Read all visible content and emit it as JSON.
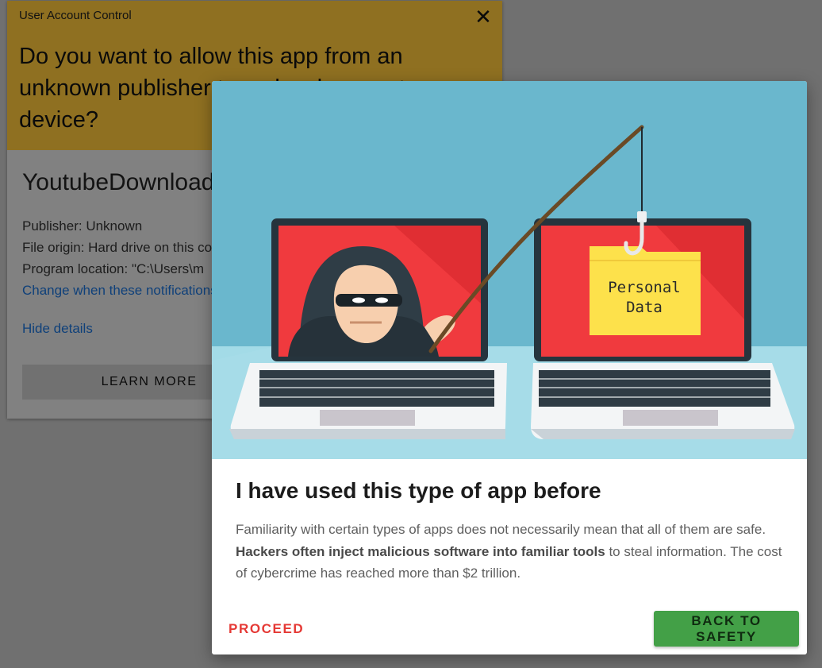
{
  "uac": {
    "caption": "User Account Control",
    "question": "Do you want to allow this app from an unknown publisher to make changes to your device?",
    "app_name": "YoutubeDownloader",
    "details": [
      "Publisher: Unknown",
      "File origin: Hard drive on this computer",
      "Program location: \"C:\\Users\\m"
    ],
    "change_link": "Change when these notifications appear",
    "hide_details": "Hide details",
    "learn_more": "LEARN MORE",
    "close_icon": "close-icon",
    "header_color": "#ffc83b"
  },
  "modal": {
    "illustration": {
      "folder_text_line1": "Personal",
      "folder_text_line2": "Data"
    },
    "title": "I have used this type of app before",
    "body_pre": "Familiarity with certain types of apps does not necessarily mean that all of them are safe. ",
    "body_bold": "Hackers often inject malicious software into familiar tools",
    "body_post": " to steal information. The cost of cybercrime has reached more than $2 trillion.",
    "proceed_label": "PROCEED",
    "safety_label": "BACK TO SAFETY",
    "colors": {
      "proceed": "#e53935",
      "safety": "#43a047",
      "sky": "#6ab7cd",
      "screen_red": "#f03a3e"
    }
  }
}
